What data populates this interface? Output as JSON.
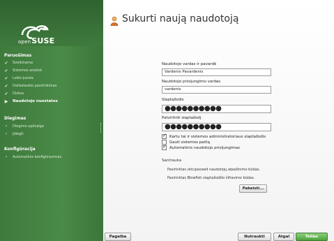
{
  "colors": {
    "sidebar": "#4a8a47",
    "accent": "#4aa33a"
  },
  "logo": {
    "prefix": "open",
    "suffix": "SUSE"
  },
  "sidebar": {
    "sections": [
      {
        "title": "Paruošimas",
        "steps": [
          {
            "label": "Sveikinama",
            "status": "done",
            "icon": "checkmark-icon"
          },
          {
            "label": "Sistemos analizė",
            "status": "done",
            "icon": "checkmark-icon"
          },
          {
            "label": "Laiko juosta",
            "status": "done",
            "icon": "checkmark-icon"
          },
          {
            "label": "Darbalaukio pasirinkimas",
            "status": "done",
            "icon": "checkmark-icon"
          },
          {
            "label": "Diskas",
            "status": "done",
            "icon": "checkmark-icon"
          },
          {
            "label": "Naudotojo nuostatos",
            "status": "current",
            "icon": "triangle-right-icon"
          }
        ]
      },
      {
        "title": "Diegimas",
        "steps": [
          {
            "label": "Diegimo apžvalga",
            "status": "pending",
            "icon": "bullet-icon"
          },
          {
            "label": "Įdiegti",
            "status": "pending",
            "icon": "bullet-icon"
          }
        ]
      },
      {
        "title": "Konfigūracija",
        "steps": [
          {
            "label": "Automatinis konfigūravimas",
            "status": "pending",
            "icon": "bullet-icon"
          }
        ]
      }
    ]
  },
  "page": {
    "title": "Sukurti naują naudotoją",
    "icon": "user-icon"
  },
  "form": {
    "fullname_label": "Naudotojo vardas ir pavardė",
    "fullname_value": "Vardenis Pavardenis",
    "username_label": "Naudotojo prisijungimo vardas",
    "username_value": "vardenis",
    "password_label": "Slaptažodis",
    "password_value": "●●●●●●●●●●",
    "confirm_label": "Patvirtinti slaptažodį",
    "confirm_value": "●●●●●●●●●●",
    "checkboxes": [
      {
        "label": "Kartu tai ir sistemos administratoriaus slaptažodis",
        "checked": true
      },
      {
        "label": "Gauti sistemos paštą",
        "checked": false
      },
      {
        "label": "Automatinis naudotojo prisijungimas",
        "checked": true
      }
    ]
  },
  "summary": {
    "title": "Santrauka",
    "lines": [
      "Pasirinktas /etc/passwd naudotojų atpažinimo būdas.",
      "Pasirinktas Blowfish slaptažodžio šifravimo būdas."
    ],
    "change_button": "Pakeisti..."
  },
  "footer": {
    "help": "Pagalba",
    "abort": "Nutraukti",
    "back": "Atgal",
    "next": "Toliau"
  }
}
